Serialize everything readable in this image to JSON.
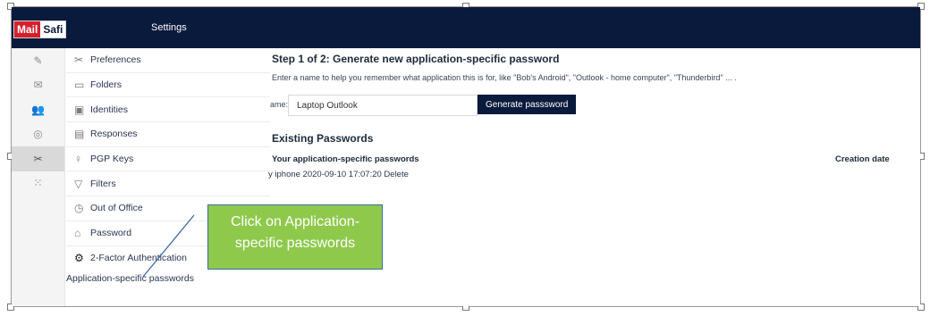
{
  "app": {
    "logo_mail": "Mail",
    "logo_safi": "Safi",
    "title": "Settings"
  },
  "rail": [
    {
      "icon": "compose-icon",
      "glyph": "✎"
    },
    {
      "icon": "inbox-icon",
      "glyph": "✉"
    },
    {
      "icon": "contacts-icon",
      "glyph": "👥"
    },
    {
      "icon": "globe-icon",
      "glyph": "◎"
    },
    {
      "icon": "tools-icon",
      "glyph": "✂"
    },
    {
      "icon": "grid-icon",
      "glyph": "⁙"
    }
  ],
  "menu": [
    {
      "label": "Preferences",
      "icon": "tools-icon",
      "glyph": "✂"
    },
    {
      "label": "Folders",
      "icon": "folder-icon",
      "glyph": "▭"
    },
    {
      "label": "Identities",
      "icon": "identity-card-icon",
      "glyph": "▣"
    },
    {
      "label": "Responses",
      "icon": "chat-icon",
      "glyph": "▤"
    },
    {
      "label": "PGP Keys",
      "icon": "key-icon",
      "glyph": "♀"
    },
    {
      "label": "Filters",
      "icon": "filter-icon",
      "glyph": "▽"
    },
    {
      "label": "Out of Office",
      "icon": "clock-icon",
      "glyph": "◷"
    },
    {
      "label": "Password",
      "icon": "lock-icon",
      "glyph": "⌂"
    },
    {
      "label": "2-Factor Authentication",
      "icon": "gear-icon",
      "glyph": "⚙"
    }
  ],
  "app_specific_link": "Application-specific passwords",
  "content": {
    "step_title": "Step 1 of 2: Generate new application-specific password",
    "description": "Enter a name to help you remember what application this is for, like \"Bob's Android\", \"Outlook - home computer\", \"Thunderbird\" ... .",
    "name_label": "ame:",
    "name_value": "Laptop Outlook",
    "generate_button": "Generate passsword",
    "existing_title": "Existing Passwords",
    "col_name": "Your application-specific passwords",
    "col_date": "Creation date",
    "rows": [
      {
        "text": "y iphone 2020-09-10 17:07:20",
        "action": "Delete"
      }
    ]
  },
  "callout": {
    "text": "Click on Application-specific passwords",
    "fill_color": "#8ec94c",
    "border_color": "#3d6aa6"
  },
  "colors": {
    "topbar": "#0a1a3c",
    "logo_red": "#d5202c"
  }
}
